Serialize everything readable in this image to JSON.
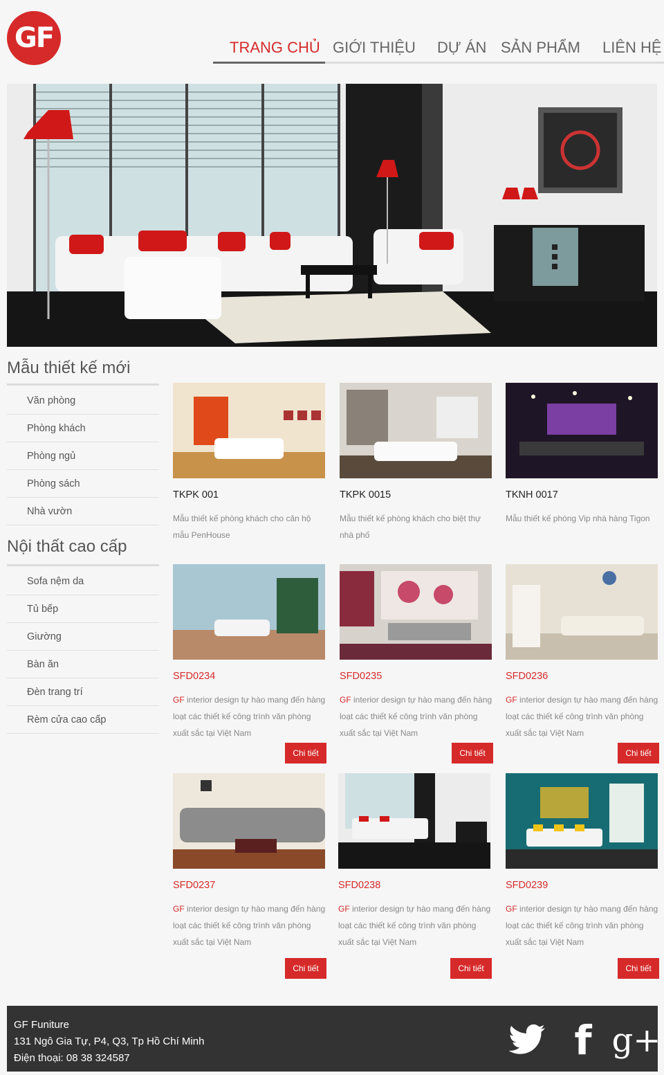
{
  "header": {
    "logo_text": "GF",
    "nav": [
      {
        "label": "TRANG CHỦ"
      },
      {
        "label": "GIỚI THIỆU"
      },
      {
        "label": "DỰ ÁN"
      },
      {
        "label": "SẢN PHẨM"
      },
      {
        "label": "LIÊN HỆ"
      }
    ]
  },
  "sidebar": {
    "sections": [
      {
        "title": "Mẫu thiết kế mới",
        "items": [
          "Văn phòng",
          "Phòng khách",
          "Phòng ngủ",
          "Phòng sách",
          "Nhà vườn"
        ]
      },
      {
        "title": "Nội thất cao cấp",
        "items": [
          "Sofa nệm da",
          "Tủ bếp",
          "Giường",
          "Bàn ăn",
          "Đèn trang trí",
          "Rèm cửa cao cấp"
        ]
      }
    ]
  },
  "new_designs": [
    {
      "code": "TKPK 001",
      "desc": "Mẫu thiết kế phòng khách cho căn hộ mẫu PenHouse"
    },
    {
      "code": "TKPK 0015",
      "desc": "Mẫu thiết kế phòng khách cho biệt thự nhà phố"
    },
    {
      "code": "TKNH 0017",
      "desc": "Mẫu thiết kế phòng Vip nhà hàng Tigon"
    }
  ],
  "products": [
    {
      "code": "SFD0234",
      "desc_hl": "GF",
      "desc": " interior design tự hào mang đến hàng loạt các thiết kế công trình văn phòng xuất sắc tại Việt Nam",
      "button": "Chi tiết"
    },
    {
      "code": "SFD0235",
      "desc_hl": "GF",
      "desc": " interior design  tự hào mang đến hàng loạt các thiết kế công trình văn phòng xuất sắc tại Việt Nam",
      "button": "Chi tiết"
    },
    {
      "code": "SFD0236",
      "desc_hl": "GF",
      "desc": " interior design  tự hào mang đến hàng loạt các thiết kế công trình văn phòng xuất sắc tại Việt Nam",
      "button": "Chi tiết"
    },
    {
      "code": "SFD0237",
      "desc_hl": "GF",
      "desc": " interior design tự hào mang đến hàng loạt các thiết kế công trình văn phòng xuất sắc tại Việt Nam",
      "button": "Chi tiết"
    },
    {
      "code": "SFD0238",
      "desc_hl": "GF",
      "desc": " interior design tự hào mang đến hàng loạt các thiết kế công trình văn phòng xuất sắc tại Việt Nam",
      "button": "Chi tiết"
    },
    {
      "code": "SFD0239",
      "desc_hl": "GF",
      "desc": " interior design tự hào mang đến hàng loạt các thiết kế công trình văn phòng xuất sắc tại Việt Nam",
      "button": "Chi tiết"
    }
  ],
  "footer": {
    "company": "GF Funiture",
    "address": "131 Ngô Gia Tự, P4, Q3, Tp Hồ Chí Minh",
    "phone": "Điện thoại: 08 38 324587",
    "social": [
      {
        "icon": "twitter-icon",
        "glyph": ""
      },
      {
        "icon": "facebook-icon",
        "glyph": "f"
      },
      {
        "icon": "google-plus-icon",
        "glyph": "g+"
      }
    ]
  },
  "colors": {
    "accent": "#d62a2a",
    "footer_bg": "#333333",
    "background": "#f6f6f6"
  }
}
